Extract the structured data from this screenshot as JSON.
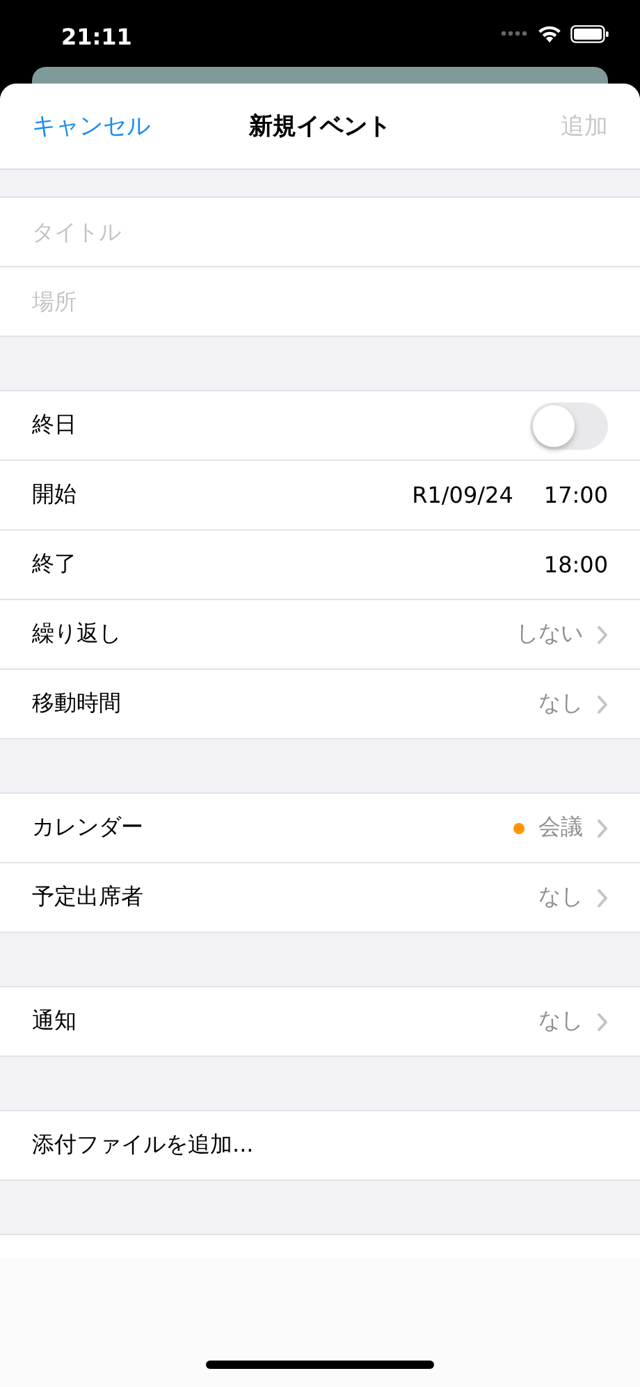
{
  "status_bar": {
    "time": "21:11"
  },
  "nav": {
    "cancel": "キャンセル",
    "title": "新規イベント",
    "add": "追加",
    "add_disabled": true
  },
  "sections": [
    {
      "rows": [
        {
          "kind": "field",
          "placeholder": "タイトル"
        },
        {
          "kind": "field",
          "placeholder": "場所"
        }
      ]
    },
    {
      "rows": [
        {
          "kind": "toggle",
          "label": "終日",
          "on": false
        },
        {
          "kind": "datetime",
          "label": "開始",
          "date": "R1/09/24",
          "time": "17:00"
        },
        {
          "kind": "datetime",
          "label": "終了",
          "time": "18:00"
        },
        {
          "kind": "link",
          "label": "繰り返し",
          "value": "しない"
        },
        {
          "kind": "link",
          "label": "移動時間",
          "value": "なし"
        }
      ]
    },
    {
      "rows": [
        {
          "kind": "link",
          "label": "カレンダー",
          "value": "会議",
          "color": "#ff9500"
        },
        {
          "kind": "link",
          "label": "予定出席者",
          "value": "なし"
        }
      ]
    },
    {
      "rows": [
        {
          "kind": "link",
          "label": "通知",
          "value": "なし"
        }
      ]
    },
    {
      "rows": [
        {
          "kind": "action",
          "label": "添付ファイルを追加..."
        }
      ]
    }
  ]
}
